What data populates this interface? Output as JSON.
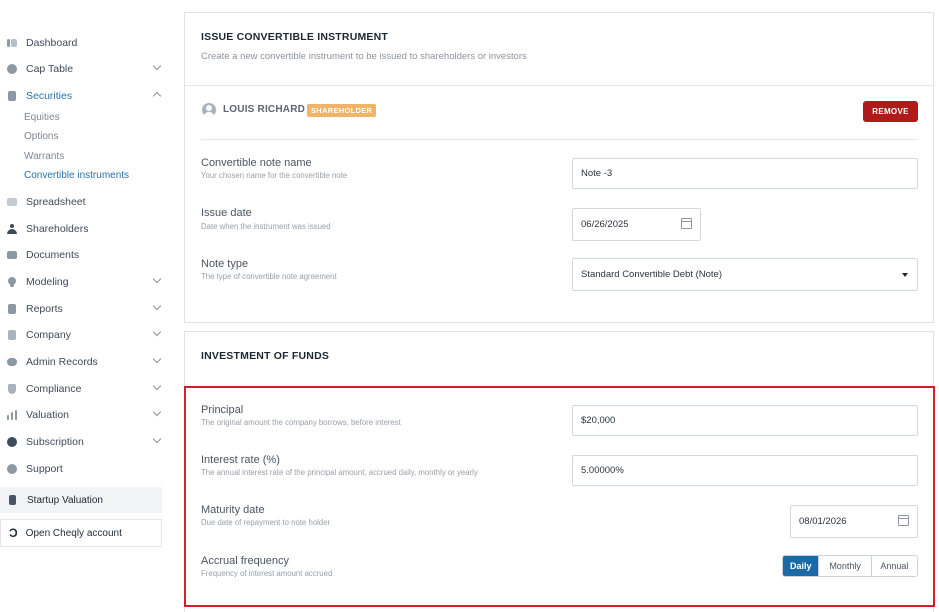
{
  "sidebar": {
    "items": [
      {
        "label": "Dashboard",
        "icon": "dashboard-icon"
      },
      {
        "label": "Cap Table",
        "icon": "pie-chart-icon"
      },
      {
        "label": "Securities",
        "icon": "clipboard-icon"
      },
      {
        "label": "Spreadsheet",
        "icon": "spreadsheet-icon"
      },
      {
        "label": "Shareholders",
        "icon": "person-icon"
      },
      {
        "label": "Documents",
        "icon": "documents-icon"
      },
      {
        "label": "Modeling",
        "icon": "lightbulb-icon"
      },
      {
        "label": "Reports",
        "icon": "reports-icon"
      },
      {
        "label": "Company",
        "icon": "building-icon"
      },
      {
        "label": "Admin Records",
        "icon": "admin-records-icon"
      },
      {
        "label": "Compliance",
        "icon": "shield-icon"
      },
      {
        "label": "Valuation",
        "icon": "bar-chart-icon"
      },
      {
        "label": "Subscription",
        "icon": "dollar-icon"
      },
      {
        "label": "Support",
        "icon": "support-icon"
      }
    ],
    "securities_sub": [
      "Equities",
      "Options",
      "Warrants",
      "Convertible instruments"
    ],
    "startup_valuation": "Startup Valuation",
    "open_cheqly": "Open Cheqly account"
  },
  "issue_card": {
    "title": "ISSUE CONVERTIBLE INSTRUMENT",
    "subtitle": "Create a new convertible instrument to be issued to shareholders or investors",
    "holder_name": "LOUIS RICHARD",
    "holder_badge": "SHAREHOLDER",
    "remove_label": "REMOVE",
    "fields": {
      "note_name_label": "Convertible note name",
      "note_name_hint": "Your chosen name for the convertible note",
      "note_name_value": "Note -3",
      "issue_date_label": "Issue date",
      "issue_date_hint": "Date when the instrument was issued",
      "issue_date_value": "06/26/2025",
      "note_type_label": "Note type",
      "note_type_hint": "The type of convertible note agreement",
      "note_type_value": "Standard Convertible Debt (Note)"
    }
  },
  "funds_card": {
    "title": "INVESTMENT OF FUNDS",
    "principal_label": "Principal",
    "principal_hint": "The original amount the company borrows, before interest",
    "principal_value": "$20,000",
    "rate_label": "Interest rate (%)",
    "rate_hint": "The annual interest rate of the principal amount, accrued daily, monthly or yearly",
    "rate_value": "5.00000%",
    "maturity_label": "Maturity date",
    "maturity_hint": "Due date of repayment to note holder",
    "maturity_value": "08/01/2026",
    "accrual_label": "Accrual frequency",
    "accrual_hint": "Frequency of interest amount accrued",
    "accrual_options": [
      "Daily",
      "Monthly",
      "Annual"
    ],
    "accrual_selected": "Daily"
  },
  "colors": {
    "accent": "#1a6aa8",
    "danger": "#b11a1a",
    "badge": "#efb467",
    "highlight": "#d1202a"
  }
}
